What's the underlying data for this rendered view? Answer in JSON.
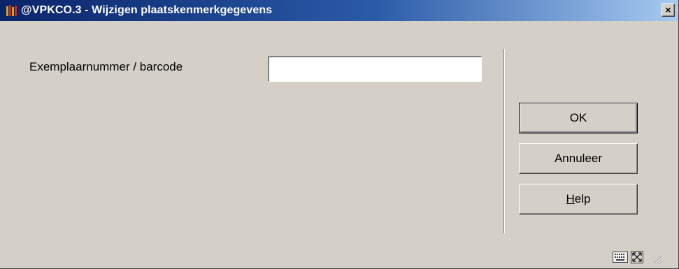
{
  "window": {
    "title": "@VPKCO.3 - Wijzigen plaatskenmerkgegevens",
    "close_glyph": "×"
  },
  "form": {
    "item_label": "Exemplaarnummer / barcode",
    "item_value": ""
  },
  "buttons": {
    "ok_label": "OK",
    "cancel_label": "Annuleer",
    "help_mnemonic": "H",
    "help_rest": "elp"
  },
  "icons": {
    "app": "books-icon",
    "keyboard": "keyboard-icon",
    "expand": "expand-icon",
    "resize": "resize-grip-icon"
  }
}
